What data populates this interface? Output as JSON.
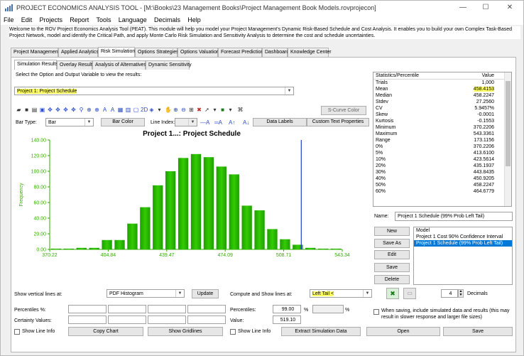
{
  "window": {
    "title": "PROJECT ECONOMICS ANALYSIS TOOL - [M:\\Books\\23 Management Books\\Project Management Book Models.rovprojecon]",
    "minimize": "—",
    "maximize": "☐",
    "close": "✕"
  },
  "menu": [
    "File",
    "Edit",
    "Projects",
    "Report",
    "Tools",
    "Language",
    "Decimals",
    "Help"
  ],
  "description": "Welcome to the ROV Project Economics Analysis Tool (PEAT). This module will help you model your Project Management's Dynamic Risk-Based Schedule and Cost Analysis. It enables you to build your own Complex Task-Based Project Network, model and identify the Critical Path, and apply Monte Carlo Risk Simulation and Sensitivity Analysis to determine the cost and schedule uncertainties.",
  "main_tabs": [
    "Project Management",
    "Applied Analytics",
    "Risk Simulation",
    "Options Strategies",
    "Options Valuation",
    "Forecast Prediction",
    "Dashboard",
    "Knowledge Center"
  ],
  "sub_tabs": [
    "Simulation Results",
    "Overlay Results",
    "Analysis of Alternatives",
    "Dynamic Sensitivity"
  ],
  "select_label": "Select the Option and Output Variable to view the results:",
  "selected_output": "Project 1: Project Schedule",
  "toolbar": {
    "scurve_color": "S-Curve Color",
    "bar_type_label": "Bar Type:",
    "bar_type_value": "Bar",
    "bar_color": "Bar Color",
    "line_index_label": "Line Index:",
    "data_labels": "Data Labels",
    "custom_text": "Custom Text Properties"
  },
  "chart_data": {
    "type": "bar",
    "title": "Project 1...: Project Schedule",
    "ylabel": "Frequency",
    "xlabel": "",
    "ylim": [
      0,
      140
    ],
    "yticks": [
      "0.00",
      "20.00",
      "40.00",
      "60.00",
      "80.00",
      "100.00",
      "120.00",
      "140.00"
    ],
    "xticks": [
      "370.22",
      "404.84",
      "439.47",
      "474.09",
      "508.71",
      "543.34"
    ],
    "xrange": [
      370.22,
      543.34
    ],
    "values": [
      1,
      1,
      2,
      2,
      12,
      12,
      33,
      54,
      82,
      100,
      117,
      122,
      118,
      106,
      96,
      56,
      50,
      26,
      13,
      6,
      2,
      1,
      1
    ],
    "vline": 519.1,
    "bar_color": "#33cc00",
    "vline_color": "#2040c8",
    "grid": false
  },
  "stats": {
    "col1": "Statistics/Percentile",
    "col2": "Value",
    "rows": [
      [
        "Trials",
        "1,000"
      ],
      [
        "Mean",
        "458.4153"
      ],
      [
        "Median",
        "458.2247"
      ],
      [
        "Stdev",
        "27.2560"
      ],
      [
        "CV",
        "5.9457%"
      ],
      [
        "Skew",
        "-0.0001"
      ],
      [
        "Kurtosis",
        "-0.1553"
      ],
      [
        "Minimum",
        "370.2206"
      ],
      [
        "Maximum",
        "543.3361"
      ],
      [
        "Range",
        "173.1156"
      ],
      [
        "0%",
        "370.2206"
      ],
      [
        "5%",
        "413.6100"
      ],
      [
        "10%",
        "423.5614"
      ],
      [
        "20%",
        "435.1937"
      ],
      [
        "30%",
        "443.8435"
      ],
      [
        "40%",
        "450.9205"
      ],
      [
        "50%",
        "458.2247"
      ],
      [
        "60%",
        "464.6779"
      ]
    ]
  },
  "name_label": "Name:",
  "name_value": "Project 1 Schedule (99% Prob Left Tail)",
  "model_buttons": [
    "New",
    "Save As",
    "Edit",
    "Save",
    "Delete"
  ],
  "model_list": {
    "header": "Model",
    "items": [
      "Project 1 Cost 90% Confidence Interval",
      "Project 1 Schedule (99% Prob Left Tail)"
    ]
  },
  "bottom": {
    "show_vlines_label": "Show vertical lines at:",
    "pdf_value": "PDF Histogram",
    "update": "Update",
    "compute_label": "Compute and Show lines at:",
    "tail_value": "Left Tail <",
    "decimals_value": "4",
    "decimals_label": "Decimals",
    "percentiles_label": "Percentiles %:",
    "certainty_label": "Certainty Values:",
    "percentiles2_label": "Percentiles:",
    "percentile_value": "99.00",
    "percent_sign": "%",
    "percent_sign2": "%",
    "value_label": "Value:",
    "value_value": "519.10",
    "save_note": "When saving, include simulated data and results (this may result in slower response and larger file sizes)",
    "show_line_info": "Show Line Info",
    "copy_chart": "Copy Chart",
    "show_gridlines": "Show Gridlines",
    "show_line_info2": "Show Line Info",
    "extract": "Extract Simulation Data",
    "open": "Open",
    "save": "Save"
  }
}
